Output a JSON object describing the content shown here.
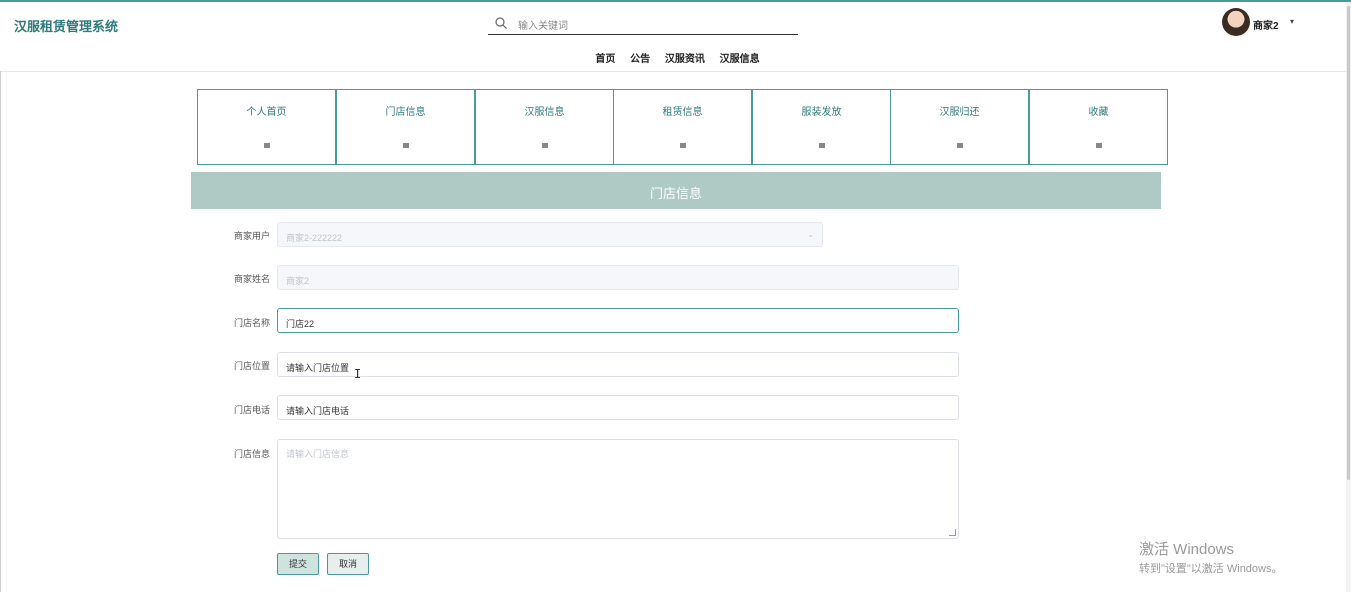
{
  "app": {
    "title": "汉服租赁管理系统"
  },
  "search": {
    "placeholder": "输入关键词",
    "icon": "search-icon"
  },
  "nav": {
    "items": [
      "首页",
      "公告",
      "汉服资讯",
      "汉服信息"
    ]
  },
  "user": {
    "name": "商家2",
    "caret": "▾"
  },
  "tiles": [
    {
      "label": "个人首页",
      "icon": "home-icon"
    },
    {
      "label": "门店信息",
      "icon": "store-icon"
    },
    {
      "label": "汉服信息",
      "icon": "clothes-icon"
    },
    {
      "label": "租赁信息",
      "icon": "rental-icon"
    },
    {
      "label": "服装发放",
      "icon": "distribute-icon"
    },
    {
      "label": "汉服归还",
      "icon": "return-icon"
    },
    {
      "label": "收藏",
      "icon": "favorite-icon"
    }
  ],
  "section": {
    "title": "门店信息"
  },
  "form": {
    "merchant_user": {
      "label": "商家用户",
      "value": "商家2-222222"
    },
    "merchant_name": {
      "label": "商家姓名",
      "value": "商家2"
    },
    "store_name": {
      "label": "门店名称",
      "value": "门店22"
    },
    "store_location": {
      "label": "门店位置",
      "value": "请输入门店位置"
    },
    "store_phone": {
      "label": "门店电话",
      "value": "请输入门店电话"
    },
    "store_info": {
      "label": "门店信息",
      "placeholder": "请输入门店信息"
    },
    "submit_label": "提交",
    "cancel_label": "取消"
  },
  "watermark": {
    "line1": "激活 Windows",
    "line2": "转到\"设置\"以激活 Windows。"
  },
  "colors": {
    "accent": "#4a9a9a",
    "banner": "#afc9c5"
  }
}
